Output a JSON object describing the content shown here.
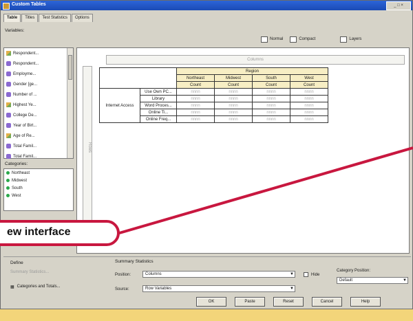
{
  "window": {
    "title": "Custom Tables",
    "title_buttons": "_ □ ×"
  },
  "tabs": [
    {
      "label": "Table"
    },
    {
      "label": "Titles"
    },
    {
      "label": "Test Statistics"
    },
    {
      "label": "Options"
    }
  ],
  "variables": {
    "label": "Variables:",
    "items": [
      {
        "label": "Respondent...",
        "type": "scale"
      },
      {
        "label": "Respondent...",
        "type": "nominal"
      },
      {
        "label": "Employme...",
        "type": "nominal"
      },
      {
        "label": "Gender [ge...",
        "type": "nominal"
      },
      {
        "label": "Number of ...",
        "type": "nominal"
      },
      {
        "label": "Highest Ye...",
        "type": "scale"
      },
      {
        "label": "College De...",
        "type": "nominal"
      },
      {
        "label": "Year of Birt...",
        "type": "nominal"
      },
      {
        "label": "Age of Re...",
        "type": "scale"
      },
      {
        "label": "Total Famil...",
        "type": "nominal"
      },
      {
        "label": "Total Famil...",
        "type": "nominal"
      }
    ]
  },
  "categories": {
    "label": "Categories:",
    "items": [
      {
        "label": "Northeast"
      },
      {
        "label": "Midwest"
      },
      {
        "label": "South"
      },
      {
        "label": "West"
      }
    ]
  },
  "view": {
    "normal": "Normal",
    "compact": "Compact",
    "layers": "Layers"
  },
  "canvas": {
    "column_zone": "Columns",
    "row_zone": "Rows",
    "region_header": "Region",
    "col_headers": [
      "Northeast",
      "Midwest",
      "South",
      "West"
    ],
    "stat_header": "Count",
    "row_category": "Internet Access",
    "row_vars": [
      "Use Own PC...",
      "Library",
      "Word Proces...",
      "Online Ti...",
      "Online Freq..."
    ],
    "cell_text": "nnnn"
  },
  "options": {
    "define_label": "Define",
    "summary_btn": "Summary Statistics...",
    "categories_btn": "Categories and Totals..."
  },
  "summary": {
    "label": "Summary Statistics",
    "position_label": "Position:",
    "position_value": "Columns",
    "source_label": "Source:",
    "source_value": "Row Variables",
    "hide_label": "Hide"
  },
  "category_position": {
    "label": "Category Position:",
    "value": "Default"
  },
  "buttons": [
    {
      "label": "OK"
    },
    {
      "label": "Paste"
    },
    {
      "label": "Reset"
    },
    {
      "label": "Cancel"
    },
    {
      "label": "Help"
    }
  ],
  "callout": {
    "text": "ew interface",
    "border_color": "#c8173f"
  }
}
